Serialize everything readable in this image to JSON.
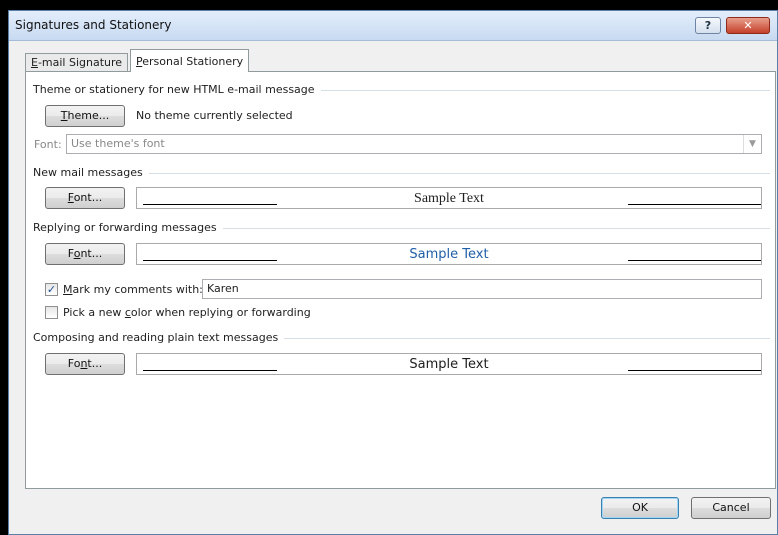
{
  "window": {
    "title": "Signatures and Stationery",
    "help_label": "?",
    "close_label": "✕"
  },
  "tabs": [
    {
      "pre": "",
      "key": "E",
      "post": "-mail Signature"
    },
    {
      "pre": "",
      "key": "P",
      "post": "ersonal Stationery"
    }
  ],
  "theme_section": {
    "heading": "Theme or stationery for new HTML e-mail message",
    "theme_button": {
      "pre": "",
      "key": "T",
      "post": "heme..."
    },
    "theme_status": "No theme currently selected",
    "font_label": "Font:",
    "font_value": "Use theme's font"
  },
  "new_mail": {
    "heading": "New mail messages",
    "font_button": {
      "pre": "",
      "key": "F",
      "post": "ont..."
    },
    "sample_text": "Sample Text"
  },
  "reply": {
    "heading": "Replying or forwarding messages",
    "font_button": {
      "pre": "F",
      "key": "o",
      "post": "nt..."
    },
    "sample_text": "Sample Text",
    "mark_comments": {
      "checked": true,
      "pre": "",
      "key": "M",
      "post": "ark my comments with:",
      "value": "Karen"
    },
    "pick_color": {
      "checked": false,
      "pre": "Pick a new ",
      "key": "c",
      "post": "olor when replying or forwarding"
    }
  },
  "plain_text": {
    "heading": "Composing and reading plain text messages",
    "font_button": {
      "pre": "Fo",
      "key": "n",
      "post": "t..."
    },
    "sample_text": "Sample Text"
  },
  "footer": {
    "ok_label": "OK",
    "cancel_label": "Cancel"
  },
  "colors": {
    "accent": "#1f5fa8",
    "titlebar": "#c8daf1",
    "close": "#c4402a"
  }
}
